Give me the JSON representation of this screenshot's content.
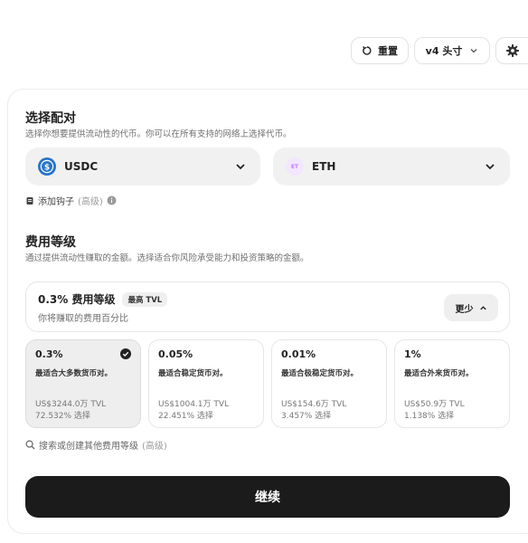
{
  "toolbar": {
    "reset_label": "重置",
    "version_label": "v4 头寸"
  },
  "pair": {
    "title": "选择配对",
    "description": "选择你想要提供流动性的代币。你可以在所有支持的网络上选择代币。",
    "token_a": {
      "symbol": "USDC",
      "icon": "usdc-icon"
    },
    "token_b": {
      "symbol": "ETH",
      "icon": "eth-icon",
      "icon_text": "ET"
    },
    "hook_label": "添加钩子",
    "hook_advanced": "(高级)"
  },
  "fee": {
    "title": "费用等级",
    "description": "通过提供流动性赚取的金额。选择适合你风险承受能力和投资策略的金额。",
    "current": {
      "title": "0.3% 费用等级",
      "badge": "最高 TVL",
      "subtitle": "你将赚取的费用百分比",
      "toggle_label": "更少"
    },
    "options": [
      {
        "pct": "0.3%",
        "best_for": "最适合大多数货币对。",
        "tvl": "US$3244.0万 TVL",
        "select_pct": "72.532% 选择",
        "selected": true
      },
      {
        "pct": "0.05%",
        "best_for": "最适合稳定货币对。",
        "tvl": "US$1004.1万 TVL",
        "select_pct": "22.451% 选择",
        "selected": false
      },
      {
        "pct": "0.01%",
        "best_for": "最适合极稳定货币对。",
        "tvl": "US$154.6万 TVL",
        "select_pct": "3.457% 选择",
        "selected": false
      },
      {
        "pct": "1%",
        "best_for": "最适合外来货币对。",
        "tvl": "US$50.9万 TVL",
        "select_pct": "1.138% 选择",
        "selected": false
      }
    ],
    "search_label": "搜索或创建其他费用等级",
    "search_advanced": "(高级)"
  },
  "continue_label": "继续",
  "colors": {
    "primary_button": "#1b1b1b",
    "usdc": "#2775ca",
    "eth_bg": "#f3e6ff",
    "eth_text": "#c57bff"
  }
}
